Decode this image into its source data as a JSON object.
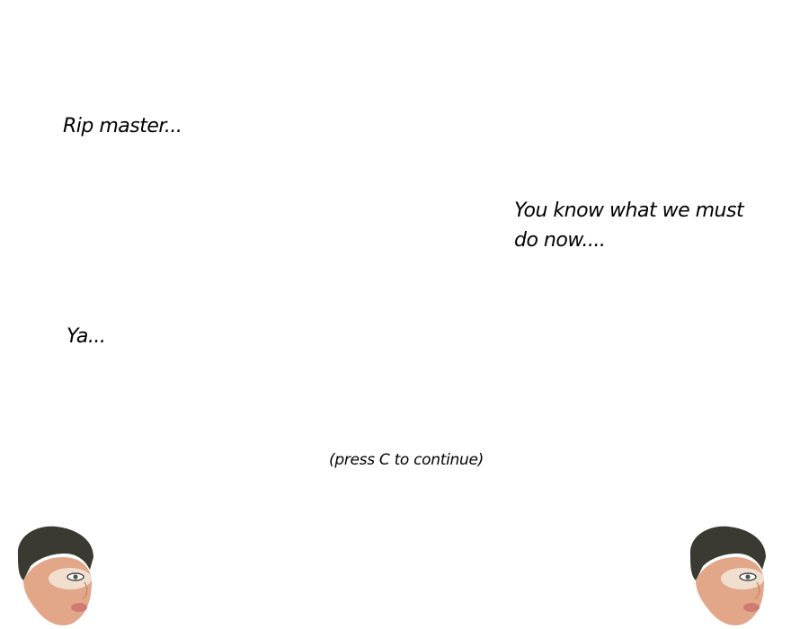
{
  "dialogue": {
    "line_1": "Rip master...",
    "line_2": "You know what we must do now....",
    "line_3": "Ya..."
  },
  "prompt": "(press C to continue)",
  "portraits": {
    "left": "character-face-icon",
    "right": "character-face-icon"
  },
  "colors": {
    "background": "#ffffff",
    "text": "#000000",
    "hair": "#3a3a32",
    "skin": "#e2a689",
    "lips": "#d07a72"
  }
}
